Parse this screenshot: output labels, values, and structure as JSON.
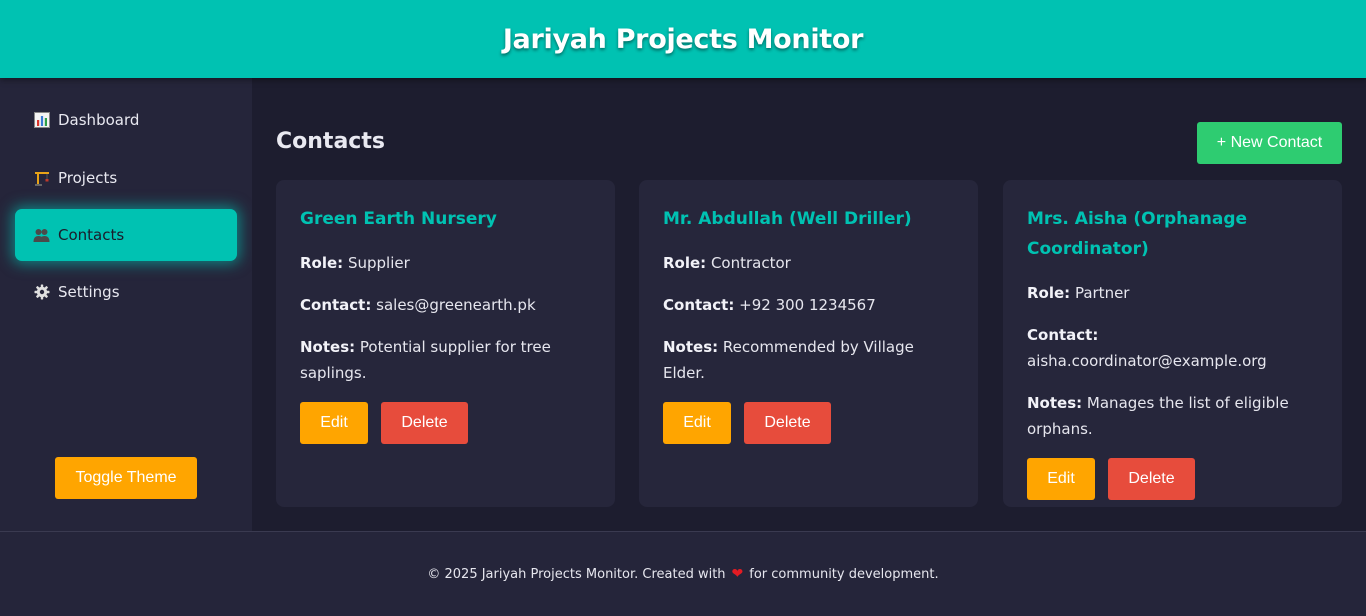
{
  "app": {
    "title": "Jariyah Projects Monitor"
  },
  "sidebar": {
    "items": [
      {
        "label": "Dashboard",
        "icon": "bar-chart-icon",
        "active": false
      },
      {
        "label": "Projects",
        "icon": "construction-crane-icon",
        "active": false
      },
      {
        "label": "Contacts",
        "icon": "people-icon",
        "active": true
      },
      {
        "label": "Settings",
        "icon": "gear-icon",
        "active": false
      }
    ],
    "toggle_theme_label": "Toggle Theme"
  },
  "main": {
    "title": "Contacts",
    "new_contact_label": "+ New Contact",
    "contacts": [
      {
        "name": "Green Earth Nursery",
        "role_label": "Role:",
        "role": "Supplier",
        "contact_label": "Contact:",
        "contact": "sales@greenearth.pk",
        "notes_label": "Notes:",
        "notes": "Potential supplier for tree saplings.",
        "edit_label": "Edit",
        "delete_label": "Delete"
      },
      {
        "name": "Mr. Abdullah (Well Driller)",
        "role_label": "Role:",
        "role": "Contractor",
        "contact_label": "Contact:",
        "contact": "+92 300 1234567",
        "notes_label": "Notes:",
        "notes": "Recommended by Village Elder.",
        "edit_label": "Edit",
        "delete_label": "Delete"
      },
      {
        "name": "Mrs. Aisha (Orphanage Coordinator)",
        "role_label": "Role:",
        "role": "Partner",
        "contact_label": "Contact:",
        "contact": "aisha.coordinator@example.org",
        "notes_label": "Notes:",
        "notes": "Manages the list of eligible orphans.",
        "edit_label": "Edit",
        "delete_label": "Delete"
      }
    ]
  },
  "footer": {
    "text_before": "© 2025 Jariyah Projects Monitor. Created with",
    "heart_icon": "heart-icon",
    "text_after": "for community development."
  },
  "colors": {
    "accent": "#00c2b2",
    "edit": "#ffa500",
    "delete": "#e74c3c",
    "new_contact": "#2ecc71"
  }
}
